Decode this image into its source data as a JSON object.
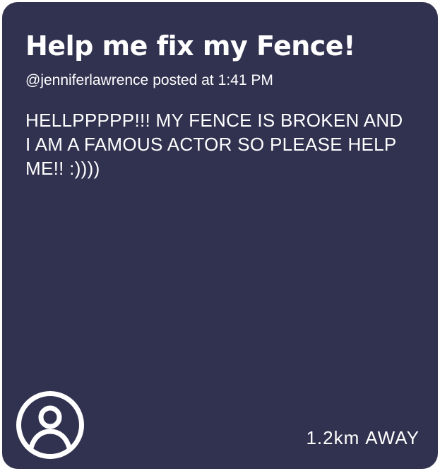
{
  "post": {
    "title": "Help me fix my Fence!",
    "author_handle": "@jenniferlawrence",
    "posted_label": "posted at",
    "time": "1:41 PM",
    "body": "HELLPPPPP!!! MY FENCE IS BROKEN AND I AM A FAMOUS ACTOR SO PLEASE HELP ME!! :))))",
    "distance": "1.2km",
    "distance_suffix": "AWAY"
  },
  "avatar": {
    "icon": "user-circle-icon"
  },
  "colors": {
    "card_background": "#313250",
    "text": "#ffffff",
    "page_background": "#ffffff"
  }
}
